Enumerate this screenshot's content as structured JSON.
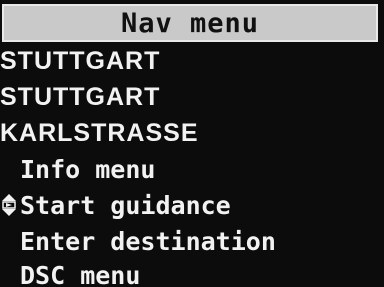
{
  "title": "Nav menu",
  "address": {
    "city": "STUTTGART",
    "district": "STUTTGART",
    "street": "KARLSTRASSE"
  },
  "menu_items": [
    {
      "label": "Info menu",
      "selected": false
    },
    {
      "label": "Start guidance",
      "selected": true
    },
    {
      "label": "Enter destination",
      "selected": false
    },
    {
      "label": "DSC menu",
      "selected": false
    }
  ],
  "cursor_icon": "rotary-selector-icon",
  "colors": {
    "background": "#0c0c0c",
    "text": "#f2f2f2",
    "title_bar": "#c9c9c9",
    "title_text": "#111111"
  }
}
